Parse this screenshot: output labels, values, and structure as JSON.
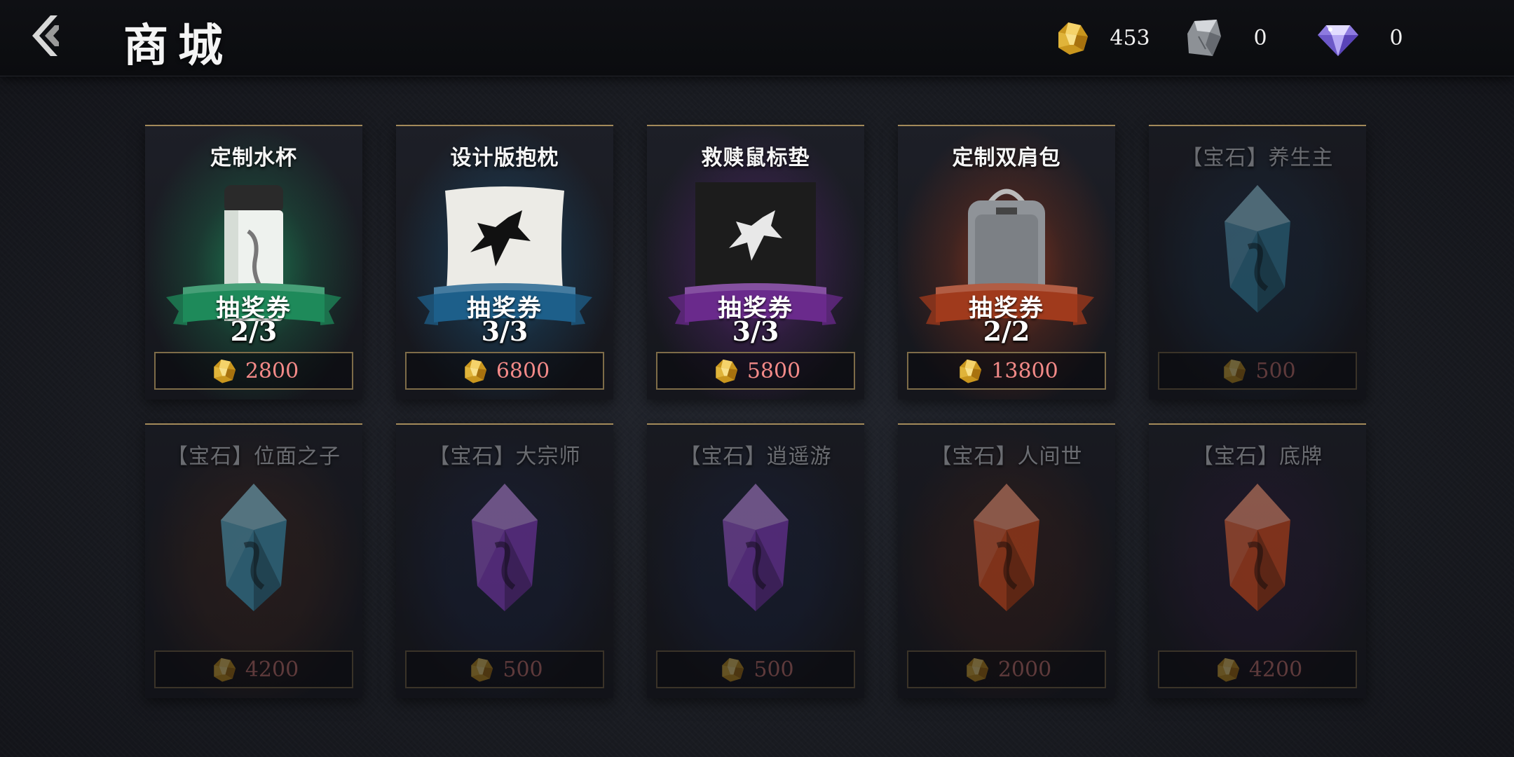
{
  "header": {
    "title": "商城",
    "currencies": [
      {
        "icon": "gold-nugget-icon",
        "value": "453"
      },
      {
        "icon": "silver-stone-icon",
        "value": "0"
      },
      {
        "icon": "diamond-icon",
        "value": "0"
      }
    ]
  },
  "items": [
    {
      "title": "定制水杯",
      "kind": "bottle",
      "badge": "抽奖券",
      "count": "2/3",
      "price": "2800",
      "theme": "#1e8a5a",
      "dim": false
    },
    {
      "title": "设计版抱枕",
      "kind": "pillow",
      "badge": "抽奖券",
      "count": "3/3",
      "price": "6800",
      "theme": "#1d5f8a",
      "dim": false
    },
    {
      "title": "救赎鼠标垫",
      "kind": "mousepad",
      "badge": "抽奖券",
      "count": "3/3",
      "price": "5800",
      "theme": "#6a2a8c",
      "dim": false
    },
    {
      "title": "定制双肩包",
      "kind": "backpack",
      "badge": "抽奖券",
      "count": "2/2",
      "price": "13800",
      "theme": "#a03a1c",
      "dim": false
    },
    {
      "title": "【宝石】养生主",
      "kind": "gem",
      "gem_color": "#2f6f8a",
      "price": "500",
      "theme": "#1f3f5e",
      "dim": true
    },
    {
      "title": "【宝石】位面之子",
      "kind": "gem",
      "gem_color": "#3a8aa8",
      "price": "4200",
      "theme": "#5a3320",
      "dim": true
    },
    {
      "title": "【宝石】大宗师",
      "kind": "gem",
      "gem_color": "#7a3ab0",
      "price": "500",
      "theme": "#1f2f5a",
      "dim": true
    },
    {
      "title": "【宝石】逍遥游",
      "kind": "gem",
      "gem_color": "#7a3ab0",
      "price": "500",
      "theme": "#1f2f5a",
      "dim": true
    },
    {
      "title": "【宝石】人间世",
      "kind": "gem",
      "gem_color": "#c4481e",
      "price": "2000",
      "theme": "#5a2a1a",
      "dim": true
    },
    {
      "title": "【宝石】底牌",
      "kind": "gem",
      "gem_color": "#c4481e",
      "price": "4200",
      "theme": "#3a1f4a",
      "dim": true
    }
  ],
  "colors": {
    "gold_border": "#a38a5a",
    "price_text": "#f38a88"
  }
}
